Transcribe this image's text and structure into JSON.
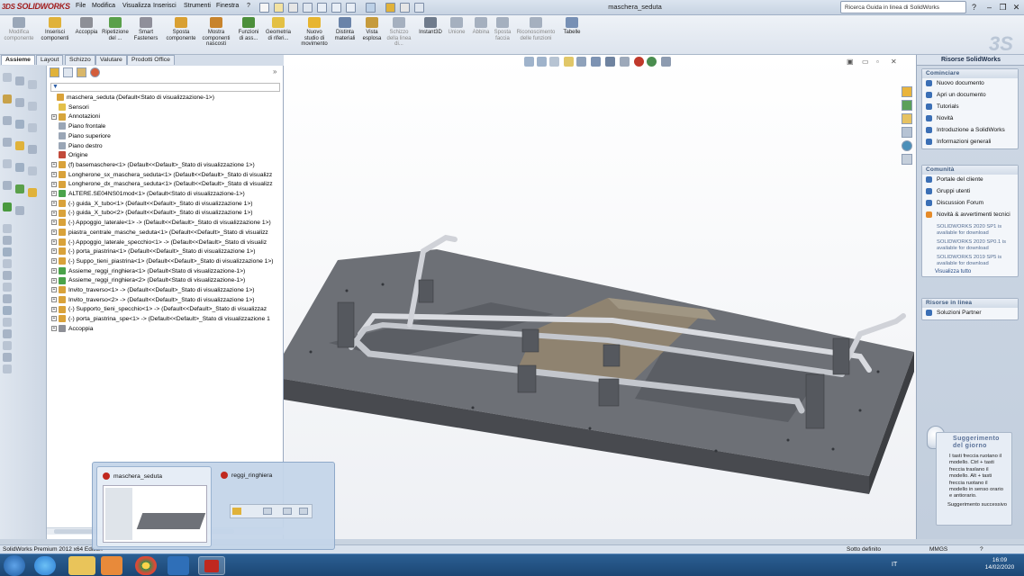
{
  "app": {
    "name": "SOLIDWORKS",
    "doc_title": "maschera_seduta",
    "version_status": "SolidWorks Premium 2012 x64 Edition"
  },
  "menu": [
    "File",
    "Modifica",
    "Visualizza",
    "Inserisci",
    "Strumenti",
    "Finestra",
    "?"
  ],
  "search_placeholder": "Ricerca Guida in linea di SolidWorks",
  "ribbon": [
    {
      "label": "Modifica componente",
      "color": "#9aa7b8",
      "disabled": true
    },
    {
      "label": "Inserisci componenti",
      "color": "#e0b23a",
      "disabled": false
    },
    {
      "label": "Accoppia",
      "color": "#8d8f96",
      "disabled": false
    },
    {
      "label": "Ripetizione del ...",
      "color": "#5aa04a",
      "disabled": false
    },
    {
      "label": "Smart Fasteners",
      "color": "#8f8f9a",
      "disabled": false
    },
    {
      "label": "Sposta componente",
      "color": "#d9a032",
      "disabled": false
    },
    {
      "label": "Mostra componenti nascosti",
      "color": "#c8842c",
      "disabled": false
    },
    {
      "label": "Funzioni di ass...",
      "color": "#4c8f3b",
      "disabled": false
    },
    {
      "label": "Geometria di riferi...",
      "color": "#e3c044",
      "disabled": false
    },
    {
      "label": "Nuovo studio di movimento",
      "color": "#e7b530",
      "disabled": false
    },
    {
      "label": "Distinta materiali",
      "color": "#6a83a9",
      "disabled": false
    },
    {
      "label": "Vista esplosa",
      "color": "#c69b3c",
      "disabled": false
    },
    {
      "label": "Schizzo della linea di...",
      "color": "#a5b0bf",
      "disabled": true
    },
    {
      "label": "Instant3D",
      "color": "#6f7b8c",
      "disabled": false
    },
    {
      "label": "Unione",
      "color": "#a5b0bf",
      "disabled": true
    },
    {
      "label": "Abbina",
      "color": "#a5b0bf",
      "disabled": true
    },
    {
      "label": "Sposta faccia",
      "color": "#a5b0bf",
      "disabled": true
    },
    {
      "label": "Riconoscimento delle funzioni",
      "color": "#a5b0bf",
      "disabled": true
    },
    {
      "label": "Tabelle",
      "color": "#7790b5",
      "disabled": false
    }
  ],
  "tabs": [
    "Assieme",
    "Layout",
    "Schizzo",
    "Valutare",
    "Prodotti Office"
  ],
  "tree": [
    {
      "label": "maschera_seduta  (Default<Stato di visualizzazione-1>)",
      "level": 0,
      "exp": "",
      "icon": "#d9a23a"
    },
    {
      "label": "Sensori",
      "level": 1,
      "exp": "",
      "icon": "#e3c04a"
    },
    {
      "label": "Annotazioni",
      "level": 1,
      "exp": "+",
      "icon": "#d6a53c"
    },
    {
      "label": "Piano frontale",
      "level": 1,
      "exp": "",
      "icon": "#9aa6b6"
    },
    {
      "label": "Piano superiore",
      "level": 1,
      "exp": "",
      "icon": "#9aa6b6"
    },
    {
      "label": "Piano destro",
      "level": 1,
      "exp": "",
      "icon": "#9aa6b6"
    },
    {
      "label": "Origine",
      "level": 1,
      "exp": "",
      "icon": "#c24a3a"
    },
    {
      "label": "(f) basemaschere<1> (Default<<Default>_Stato di visualizzazione 1>)",
      "level": 1,
      "exp": "+",
      "icon": "#d9a23a"
    },
    {
      "label": "Longherone_sx_maschera_seduta<1> (Default<<Default>_Stato di visualizz",
      "level": 1,
      "exp": "+",
      "icon": "#d9a23a"
    },
    {
      "label": "Longherone_dx_maschera_seduta<1> (Default<<Default>_Stato di visualizz",
      "level": 1,
      "exp": "+",
      "icon": "#d9a23a"
    },
    {
      "label": "ALTERE.SE04NS01mod<1> (Default<Stato di visualizzazione-1>)",
      "level": 1,
      "exp": "+",
      "icon": "#4aa34a"
    },
    {
      "label": "(-) guida_X_tubo<1> (Default<<Default>_Stato di visualizzazione 1>)",
      "level": 1,
      "exp": "+",
      "icon": "#d9a23a"
    },
    {
      "label": "(-) guida_X_tubo<2> (Default<<Default>_Stato di visualizzazione 1>)",
      "level": 1,
      "exp": "+",
      "icon": "#d9a23a"
    },
    {
      "label": "(-) Appoggio_laterale<1> -> (Default<<Default>_Stato di visualizzazione 1>)",
      "level": 1,
      "exp": "+",
      "icon": "#d9a23a"
    },
    {
      "label": "piastra_centrale_masche_seduta<1> (Default<<Default>_Stato di visualizz",
      "level": 1,
      "exp": "+",
      "icon": "#d9a23a"
    },
    {
      "label": "(-) Appoggio_laterale_specchio<1> -> (Default<<Default>_Stato di visualiz",
      "level": 1,
      "exp": "+",
      "icon": "#d9a23a"
    },
    {
      "label": "(-) porta_piastrina<1> (Default<<Default>_Stato di visualizzazione 1>)",
      "level": 1,
      "exp": "+",
      "icon": "#d9a23a"
    },
    {
      "label": "(-) Suppo_tieni_piastrina<1> (Default<<Default>_Stato di visualizzazione 1>)",
      "level": 1,
      "exp": "+",
      "icon": "#d9a23a"
    },
    {
      "label": "Assieme_reggi_ringhiera<1> (Default<Stato di visualizzazione-1>)",
      "level": 1,
      "exp": "+",
      "icon": "#4aa34a"
    },
    {
      "label": "Assieme_reggi_ringhiera<2> (Default<Stato di visualizzazione-1>)",
      "level": 1,
      "exp": "+",
      "icon": "#4aa34a"
    },
    {
      "label": "Invito_traverso<1> -> (Default<<Default>_Stato di visualizzazione 1>)",
      "level": 1,
      "exp": "+",
      "icon": "#d9a23a"
    },
    {
      "label": "Invito_traverso<2> -> (Default<<Default>_Stato di visualizzazione 1>)",
      "level": 1,
      "exp": "+",
      "icon": "#d9a23a"
    },
    {
      "label": "(-) Supporto_tieni_specchio<1> -> (Default<<Default>_Stato di visualizzaz",
      "level": 1,
      "exp": "+",
      "icon": "#d9a23a"
    },
    {
      "label": "(-) porta_piastrina_spe<1> -> (Default<<Default>_Stato di visualizzazione 1",
      "level": 1,
      "exp": "+",
      "icon": "#d9a23a"
    },
    {
      "label": "Accoppia",
      "level": 1,
      "exp": "+",
      "icon": "#8d8f96"
    }
  ],
  "taskpane": {
    "title": "Risorse SolidWorks",
    "sections": [
      {
        "header": "Cominciare",
        "items": [
          "Nuovo documento",
          "Apri un documento",
          "Tutorials",
          "Novità",
          "Introduzione a SolidWorks",
          "Informazioni generali"
        ]
      },
      {
        "header": "Comunità",
        "items": [
          "Portale del cliente",
          "Gruppi utenti",
          "Discussion Forum",
          "Novità & avvertimenti tecnici"
        ],
        "news": [
          "SOLIDWORKS 2020 SP1 is available for download",
          "SOLIDWORKS 2020 SP0.1 is available for download",
          "SOLIDWORKS 2019 SP5 is available for download"
        ],
        "more": "Visualizza tutto"
      },
      {
        "header": "Risorse in linea",
        "items": [
          "Soluzioni Partner"
        ]
      }
    ],
    "tip": {
      "header": "Suggerimento del giorno",
      "body": "I tasti freccia ruotano il modello. Ctrl + tasti freccia traslano il modello. Alt + tasti freccia ruotano il modello in senso orario e antiorario.",
      "more": "Suggerimento successivo"
    }
  },
  "status": {
    "left": "SolidWorks Premium 2012 x64 Edition",
    "center": "Sotto definito",
    "units": "MMGS",
    "help": "?"
  },
  "thumbnails": [
    {
      "title": "maschera_seduta"
    },
    {
      "title": "reggi_ringhiera"
    }
  ],
  "taskbar": {
    "lang": "IT",
    "time": "16:09",
    "date": "14/02/2020"
  },
  "colors": {
    "ribbon_bg": "#e6ecf4",
    "part_gray": "#6e7178",
    "accent_red": "#c0281f"
  }
}
